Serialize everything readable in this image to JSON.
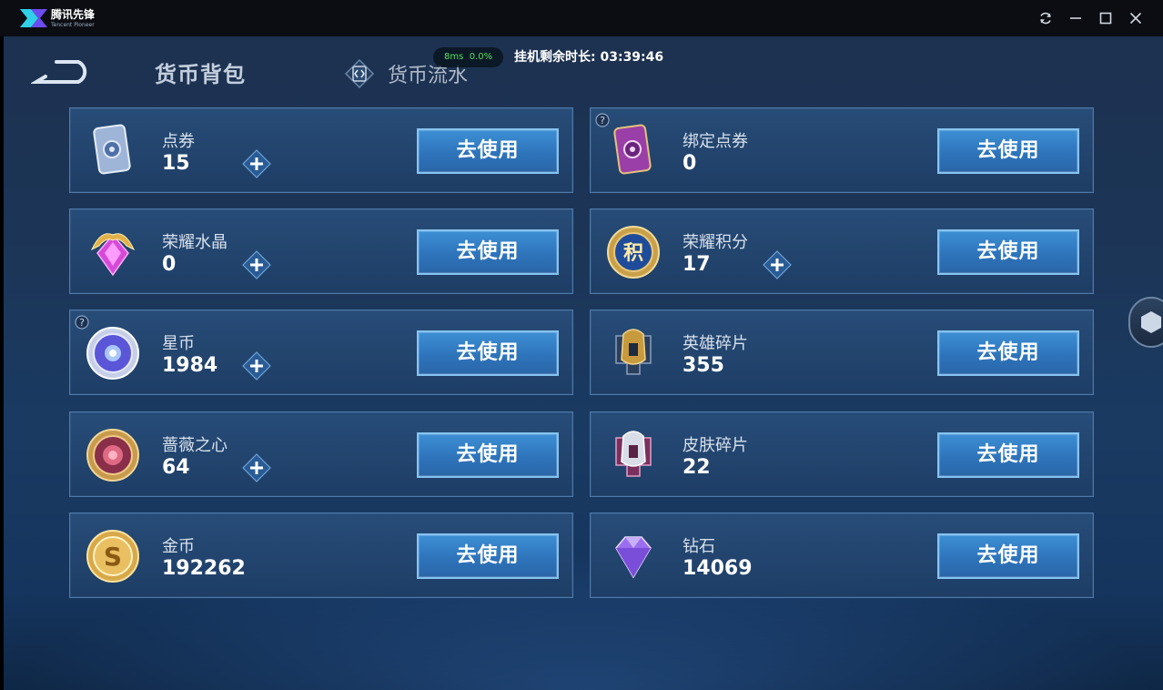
{
  "titlebar": {
    "app_name": "腾讯先锋",
    "app_sub": "Tencent Pioneer"
  },
  "header": {
    "title": "货币背包",
    "flow_tab_label": "货币流水",
    "ping": "8ms",
    "loss": "0.0%",
    "timer_label": "挂机剩余时长:",
    "timer_value": "03:39:46"
  },
  "use_label": "去使用",
  "currencies": [
    {
      "name": "点券",
      "value": "15",
      "icon": "voucher-card-icon",
      "has_plus": true,
      "has_help": false
    },
    {
      "name": "绑定点券",
      "value": "0",
      "icon": "bound-voucher-card-icon",
      "has_plus": false,
      "has_help": true
    },
    {
      "name": "荣耀水晶",
      "value": "0",
      "icon": "glory-crystal-icon",
      "has_plus": true,
      "has_help": false
    },
    {
      "name": "荣耀积分",
      "value": "17",
      "icon": "glory-points-icon",
      "has_plus": true,
      "has_help": false
    },
    {
      "name": "星币",
      "value": "1984",
      "icon": "star-coin-icon",
      "has_plus": true,
      "has_help": true
    },
    {
      "name": "英雄碎片",
      "value": "355",
      "icon": "hero-fragment-icon",
      "has_plus": false,
      "has_help": false
    },
    {
      "name": "蔷薇之心",
      "value": "64",
      "icon": "rose-heart-icon",
      "has_plus": true,
      "has_help": false
    },
    {
      "name": "皮肤碎片",
      "value": "22",
      "icon": "skin-fragment-icon",
      "has_plus": false,
      "has_help": false
    },
    {
      "name": "金币",
      "value": "192262",
      "icon": "gold-coin-icon",
      "has_plus": false,
      "has_help": false
    },
    {
      "name": "钻石",
      "value": "14069",
      "icon": "diamond-icon",
      "has_plus": false,
      "has_help": false
    }
  ]
}
